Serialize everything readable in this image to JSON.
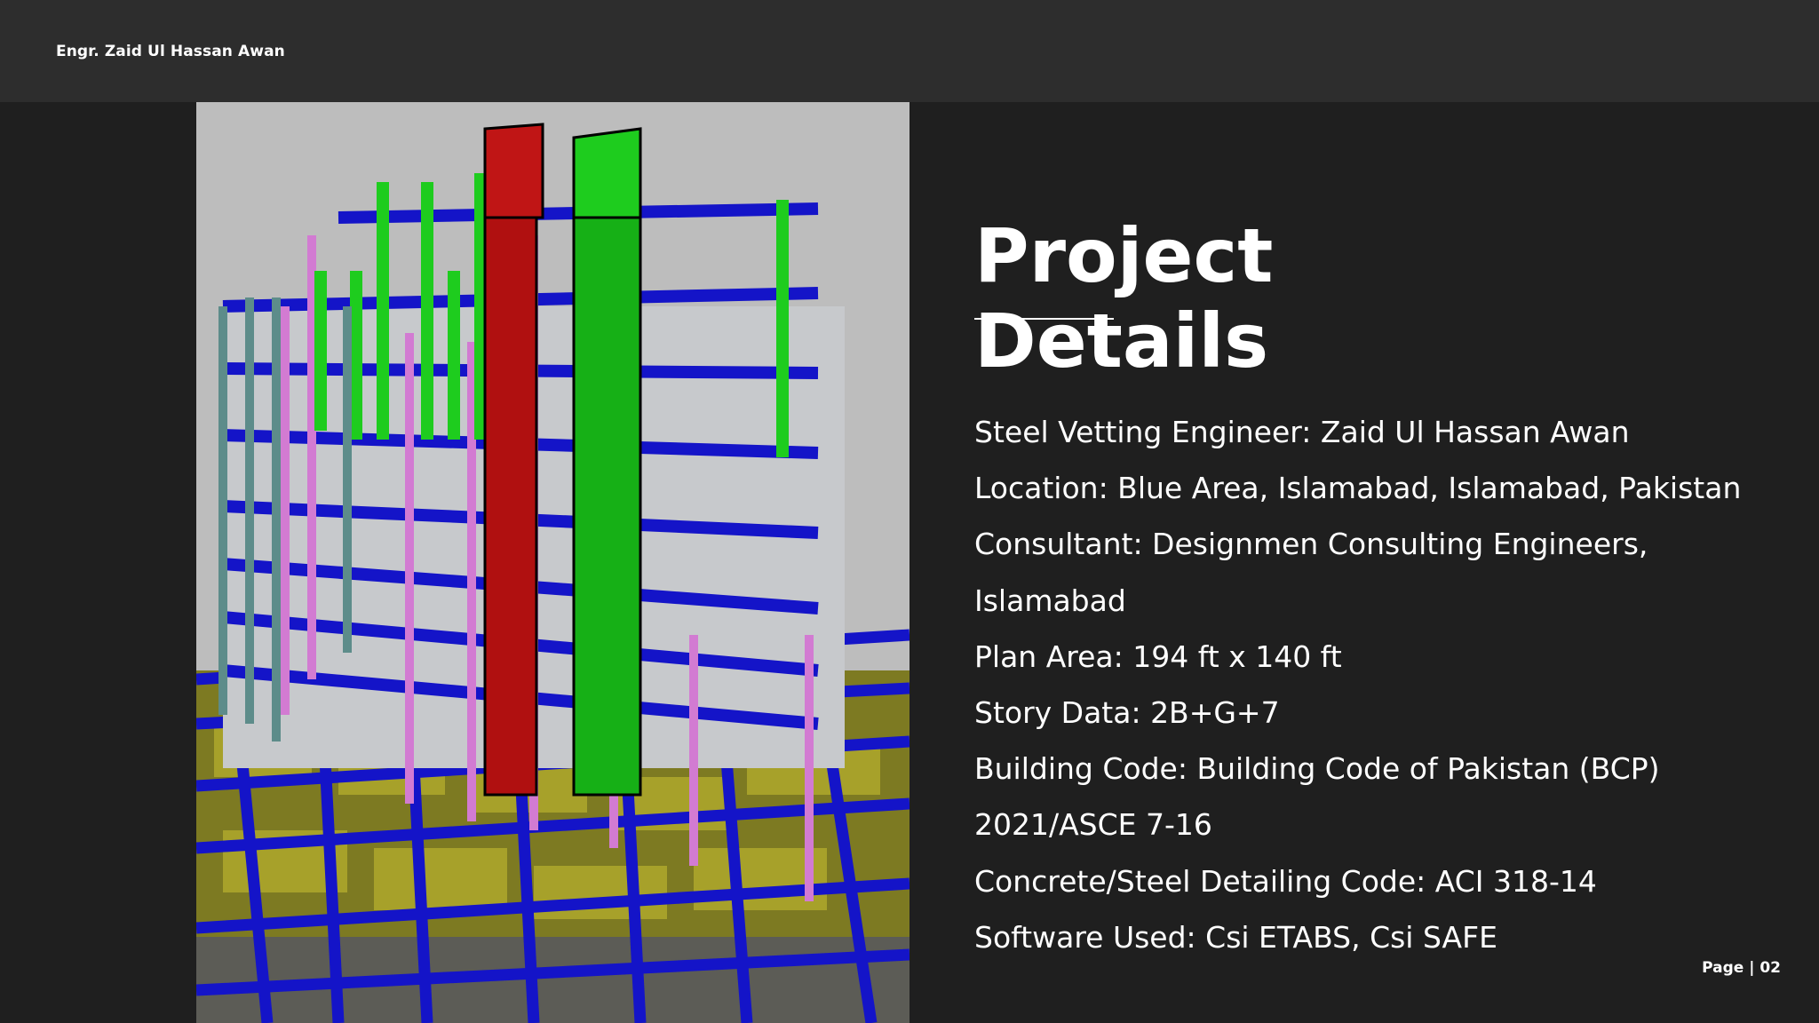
{
  "header": {
    "author": "Engr. Zaid Ul Hassan Awan"
  },
  "image": {
    "alt": "ETABS 3D structural model",
    "colors": {
      "beams": "#1414c8",
      "columns_green": "#1ecc1e",
      "columns_pink": "#d27bd2",
      "core_red": "#b01010",
      "slab_yellow": "#8a8a1e",
      "background": "#bdbdbd"
    }
  },
  "title": {
    "line1": "Project",
    "line2": "Details"
  },
  "details": [
    "Steel Vetting Engineer: Zaid Ul Hassan Awan",
    "Location:  Blue Area, Islamabad, Islamabad, Pakistan",
    "Consultant: Designmen Consulting Engineers, Islamabad",
    "Plan Area: 194 ft x 140 ft",
    "Story Data: 2B+G+7",
    "Building Code: Building Code of Pakistan (BCP) 2021/ASCE 7-16",
    "Concrete/Steel Detailing Code: ACI 318-14",
    "Software Used: Csi ETABS, Csi SAFE"
  ],
  "footer": {
    "page_label": "Page | 02"
  }
}
